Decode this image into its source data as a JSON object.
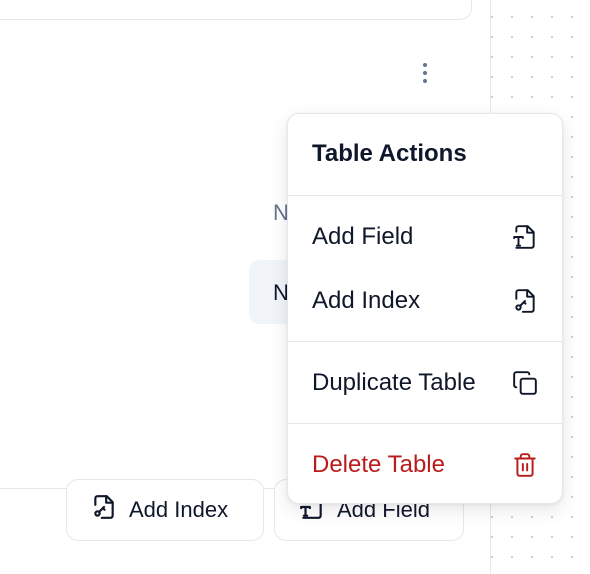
{
  "table_panel": {
    "partial_label": "N",
    "partial_pill_label": "N"
  },
  "bottom_buttons": {
    "add_index_label": "Add Index",
    "add_field_label": "Add Field"
  },
  "menu": {
    "title": "Table Actions",
    "items": [
      {
        "label": "Add Field",
        "icon": "file-type-icon"
      },
      {
        "label": "Add Index",
        "icon": "file-key-icon"
      },
      {
        "label": "Duplicate Table",
        "icon": "copy-icon"
      },
      {
        "label": "Delete Table",
        "icon": "trash-icon",
        "color": "#b91c1c"
      }
    ]
  },
  "colors": {
    "danger": "#b91c1c",
    "text": "#0f172a",
    "muted": "#64748b",
    "border": "#e5e7eb"
  }
}
